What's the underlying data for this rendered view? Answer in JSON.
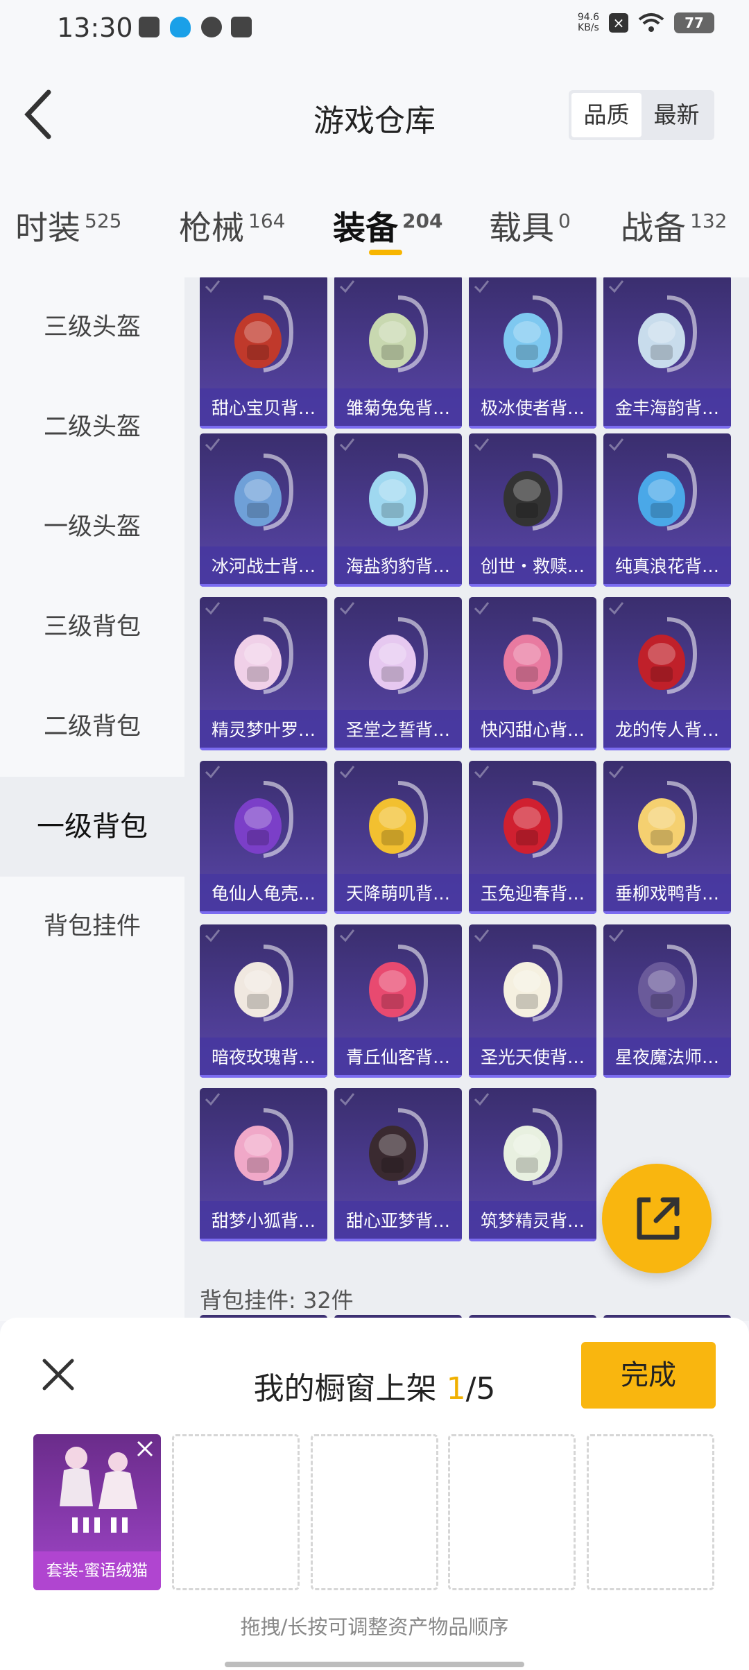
{
  "status_bar": {
    "time": "13:30",
    "net_speed_top": "94.6",
    "net_speed_unit": "KB/s",
    "battery": "77"
  },
  "header": {
    "title": "游戏仓库",
    "sort_options": [
      "品质",
      "最新"
    ],
    "active_sort": "品质"
  },
  "tabs": [
    {
      "label": "时装",
      "count": "525"
    },
    {
      "label": "枪械",
      "count": "164"
    },
    {
      "label": "装备",
      "count": "204",
      "active": true
    },
    {
      "label": "载具",
      "count": "0"
    },
    {
      "label": "战备",
      "count": "132"
    }
  ],
  "sidebar": [
    {
      "label": "三级头盔"
    },
    {
      "label": "二级头盔"
    },
    {
      "label": "一级头盔"
    },
    {
      "label": "三级背包"
    },
    {
      "label": "二级背包"
    },
    {
      "label": "一级背包",
      "active": true
    },
    {
      "label": "背包挂件"
    }
  ],
  "items": [
    {
      "label": "甜心宝贝背…",
      "icon": "backpack-icon",
      "color": "#c0392b"
    },
    {
      "label": "雏菊兔兔背…",
      "icon": "backpack-icon",
      "color": "#c8d8b0"
    },
    {
      "label": "极冰使者背…",
      "icon": "backpack-icon",
      "color": "#7ec8f0"
    },
    {
      "label": "金丰海韵背…",
      "icon": "backpack-icon",
      "color": "#c8dcec"
    },
    {
      "label": "冰河战士背…",
      "icon": "backpack-icon",
      "color": "#6fa0d8"
    },
    {
      "label": "海盐豹豹背…",
      "icon": "backpack-icon",
      "color": "#9fd8f0"
    },
    {
      "label": "创世・救赎…",
      "icon": "backpack-icon",
      "color": "#333333"
    },
    {
      "label": "纯真浪花背…",
      "icon": "backpack-icon",
      "color": "#4aa8e8"
    },
    {
      "label": "精灵梦叶罗…",
      "icon": "backpack-icon",
      "color": "#f0d0e8"
    },
    {
      "label": "圣堂之誓背…",
      "icon": "backpack-icon",
      "color": "#e6c8f0"
    },
    {
      "label": "快闪甜心背…",
      "icon": "backpack-icon",
      "color": "#e87aa0"
    },
    {
      "label": "龙的传人背…",
      "icon": "backpack-icon",
      "color": "#c0202a"
    },
    {
      "label": "龟仙人龟壳…",
      "icon": "backpack-icon",
      "color": "#7b3fc8"
    },
    {
      "label": "天降萌叽背…",
      "icon": "backpack-icon",
      "color": "#f2c030"
    },
    {
      "label": "玉兔迎春背…",
      "icon": "backpack-icon",
      "color": "#d02030"
    },
    {
      "label": "垂柳戏鸭背…",
      "icon": "backpack-icon",
      "color": "#f5d070"
    },
    {
      "label": "暗夜玫瑰背…",
      "icon": "backpack-icon",
      "color": "#f0e8e0"
    },
    {
      "label": "青丘仙客背…",
      "icon": "backpack-icon",
      "color": "#e84a70"
    },
    {
      "label": "圣光天使背…",
      "icon": "backpack-icon",
      "color": "#f5f0e0"
    },
    {
      "label": "星夜魔法师…",
      "icon": "backpack-icon",
      "color": "#6a5a9a"
    },
    {
      "label": "甜梦小狐背…",
      "icon": "backpack-icon",
      "color": "#f0a8c8"
    },
    {
      "label": "甜心亚梦背…",
      "icon": "backpack-icon",
      "color": "#3a2a30"
    },
    {
      "label": "筑梦精灵背…",
      "icon": "backpack-icon",
      "color": "#e8f0e0"
    }
  ],
  "section_count": "背包挂件: 32件",
  "showcase": {
    "title_prefix": "我的橱窗上架 ",
    "current": "1",
    "total": "/5",
    "done_label": "完成",
    "filled_label": "套装-蜜语绒猫",
    "hint": "拖拽/长按可调整资产物品顺序"
  },
  "colors": {
    "accent": "#f9b60f",
    "card_bg": "#4b3b8f",
    "slot_filled": "#a347c8"
  }
}
